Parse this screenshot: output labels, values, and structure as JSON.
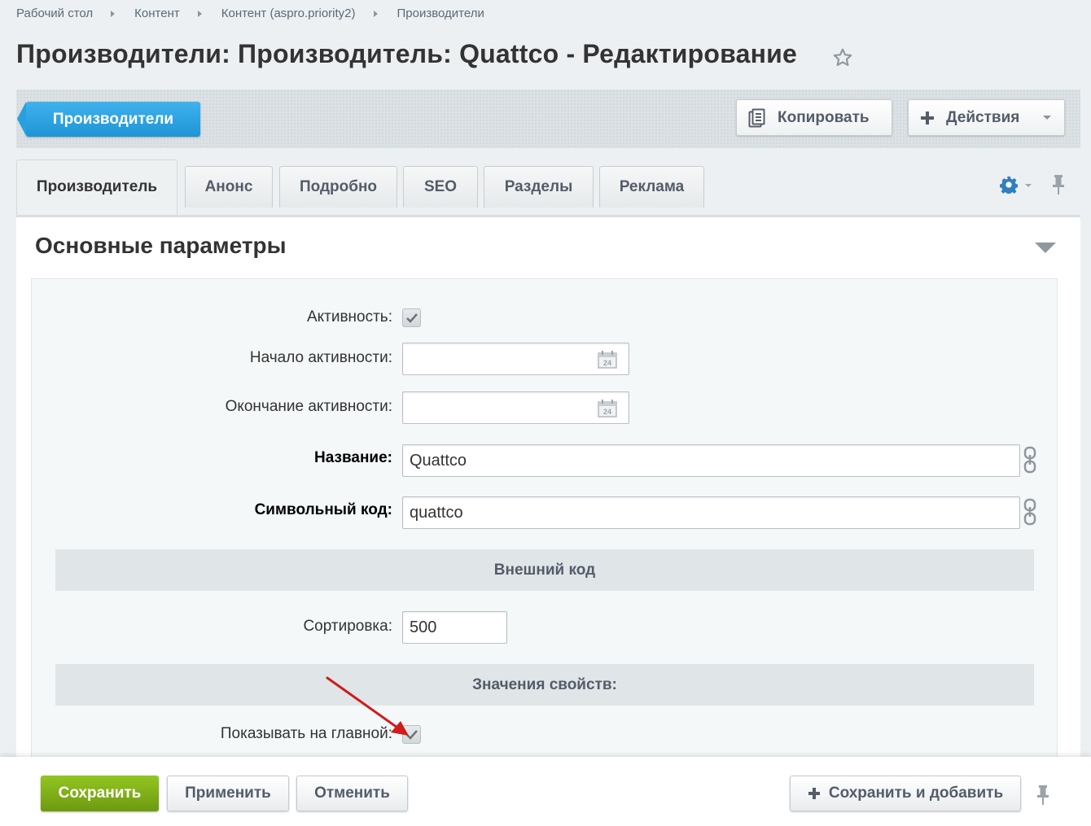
{
  "breadcrumb": [
    "Рабочий стол",
    "Контент",
    "Контент (aspro.priority2)",
    "Производители"
  ],
  "page_title": "Производители: Производитель: Quattco - Редактирование",
  "toolbar": {
    "back_label": "Производители",
    "copy_label": "Копировать",
    "actions_label": "Действия"
  },
  "tabs": [
    "Производитель",
    "Анонс",
    "Подробно",
    "SEO",
    "Разделы",
    "Реклама"
  ],
  "section_title": "Основные параметры",
  "form": {
    "active_label": "Активность:",
    "active_checked": true,
    "active_from_label": "Начало активности:",
    "active_from_value": "",
    "active_to_label": "Окончание активности:",
    "active_to_value": "",
    "name_label": "Название:",
    "name_value": "Quattco",
    "code_label": "Символьный код:",
    "code_value": "quattco",
    "external_code_header": "Внешний код",
    "sort_label": "Сортировка:",
    "sort_value": "500",
    "properties_header": "Значения свойств:",
    "show_main_label": "Показывать на главной:",
    "show_main_checked": true
  },
  "footer": {
    "save_label": "Сохранить",
    "apply_label": "Применить",
    "cancel_label": "Отменить",
    "save_add_label": "Сохранить и добавить"
  },
  "colors": {
    "accent_blue": "#2fa4e7",
    "save_green": "#7bae14",
    "arrow_red": "#d01c1c"
  }
}
